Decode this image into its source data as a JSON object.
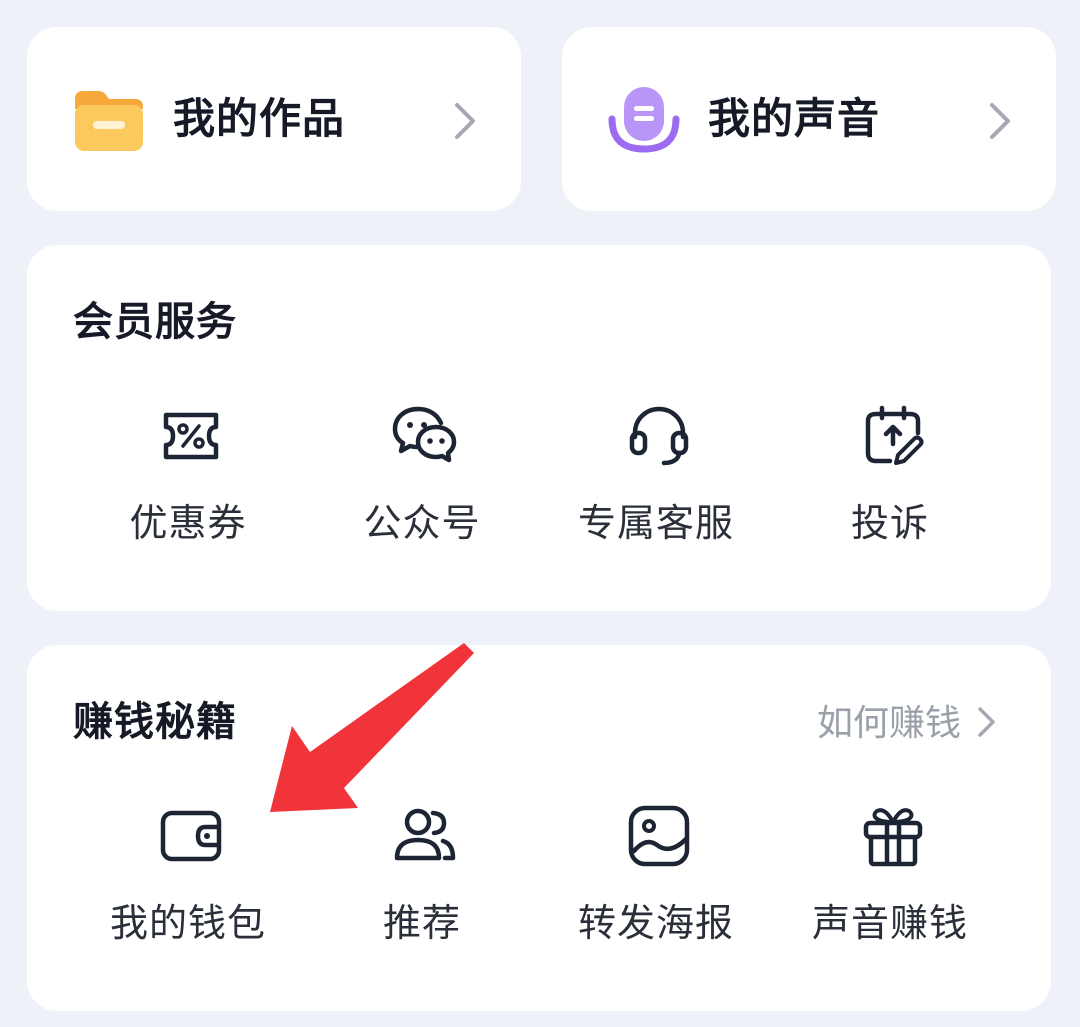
{
  "shortcuts": {
    "works": {
      "label": "我的作品",
      "icon": "folder-icon"
    },
    "voice": {
      "label": "我的声音",
      "icon": "microphone-icon"
    }
  },
  "member_services": {
    "title": "会员服务",
    "items": [
      {
        "label": "优惠券",
        "icon": "coupon-icon"
      },
      {
        "label": "公众号",
        "icon": "wechat-icon"
      },
      {
        "label": "专属客服",
        "icon": "headset-icon"
      },
      {
        "label": "投诉",
        "icon": "complaint-icon"
      }
    ]
  },
  "earn_money": {
    "title": "赚钱秘籍",
    "link_label": "如何赚钱",
    "items": [
      {
        "label": "我的钱包",
        "icon": "wallet-icon"
      },
      {
        "label": "推荐",
        "icon": "users-icon"
      },
      {
        "label": "转发海报",
        "icon": "poster-icon"
      },
      {
        "label": "声音赚钱",
        "icon": "gift-icon"
      }
    ]
  },
  "colors": {
    "page_bg": "#eef2f8",
    "card_bg": "#ffffff",
    "text_primary": "#161a26",
    "text_secondary": "#9aa0aa",
    "icon_stroke": "#1d2433",
    "folder": "#f8b84a",
    "microphone": "#9b6bf2",
    "annotation_arrow": "#f0343a"
  }
}
